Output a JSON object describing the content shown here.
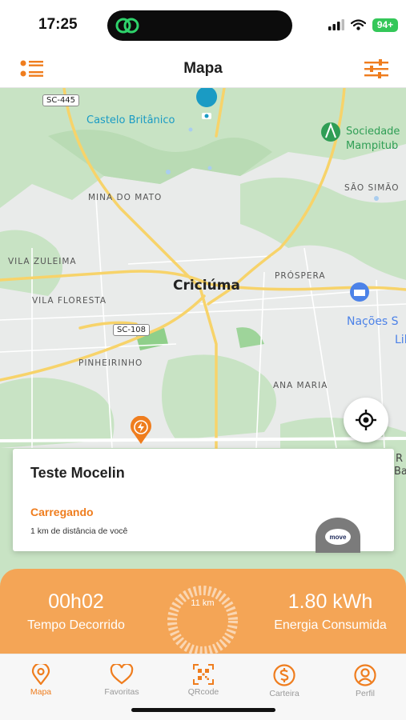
{
  "status_bar": {
    "time": "17:25",
    "battery": "94+"
  },
  "header": {
    "title": "Mapa",
    "menu_icon": "list-icon",
    "filter_icon": "sliders-icon"
  },
  "map": {
    "labels": {
      "castelo": "Castelo Britânico",
      "sociedade_1": "Sociedade",
      "sociedade_2": "Mampitub",
      "sao_simao": "SÃO SIMÃO",
      "mina": "MINA DO MATO",
      "vila_zuleima": "VILA ZULEIMA",
      "criciuma": "Criciúma",
      "prospera": "PRÓSPERA",
      "vila_floresta": "VILA FLORESTA",
      "nacoes": "Nações S",
      "pinheirinho": "PINHEIRINHO",
      "ana_maria": "ANA MARIA",
      "sc445": "SC-445",
      "sc108": "SC-108",
      "edge_lib": "Lib",
      "edge_ba": "Ba",
      "edge_r": "R",
      "edge_ba2": "Ba"
    }
  },
  "station": {
    "name": "Teste Mocelin",
    "status": "Carregando",
    "distance": "1 km de distância de você",
    "brand": "move"
  },
  "charging": {
    "elapsed_value": "00h02",
    "elapsed_label": "Tempo Decorrido",
    "distance_value": "11 km",
    "energy_value": "1.80 kWh",
    "energy_label": "Energia Consumida"
  },
  "tabs": [
    {
      "label": "Mapa",
      "icon": "map-pin-icon",
      "active": true
    },
    {
      "label": "Favoritas",
      "icon": "heart-icon",
      "active": false
    },
    {
      "label": "QRcode",
      "icon": "qrcode-icon",
      "active": false
    },
    {
      "label": "Carteira",
      "icon": "wallet-icon",
      "active": false
    },
    {
      "label": "Perfil",
      "icon": "profile-icon",
      "active": false
    }
  ],
  "colors": {
    "accent": "#ef7d1e",
    "charge_bar": "#f4a556",
    "road": "#f7d36a",
    "park": "#c8e3c4",
    "water": "#a9cdef",
    "battery": "#34c759"
  }
}
